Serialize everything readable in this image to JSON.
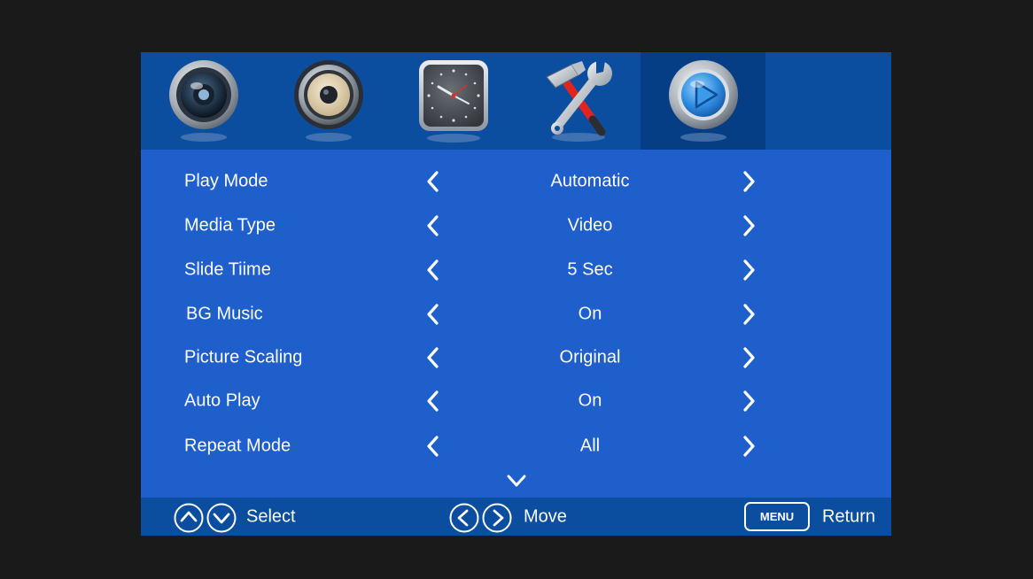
{
  "tabs": [
    {
      "icon": "camera-lens-icon",
      "label": "Picture"
    },
    {
      "icon": "speaker-icon",
      "label": "Sound"
    },
    {
      "icon": "clock-icon",
      "label": "Time"
    },
    {
      "icon": "tools-icon",
      "label": "Setup"
    },
    {
      "icon": "play-icon",
      "label": "Media",
      "active": true
    }
  ],
  "settings": [
    {
      "label": "Play Mode",
      "value": "Automatic"
    },
    {
      "label": "Media Type",
      "value": "Video"
    },
    {
      "label": "Slide Tiime",
      "value": "5 Sec"
    },
    {
      "label": "BG Music",
      "value": "On"
    },
    {
      "label": "Picture Scaling",
      "value": "Original"
    },
    {
      "label": "Auto Play",
      "value": "On"
    },
    {
      "label": "Repeat Mode",
      "value": "All"
    }
  ],
  "footer": {
    "select_label": "Select",
    "move_label": "Move",
    "menu_key": "MENU",
    "return_label": "Return"
  },
  "colors": {
    "page_bg": "#1a1a1a",
    "panel": "#1f5fcc",
    "bar": "#0b4ea0",
    "active_tab": "#053e84"
  }
}
